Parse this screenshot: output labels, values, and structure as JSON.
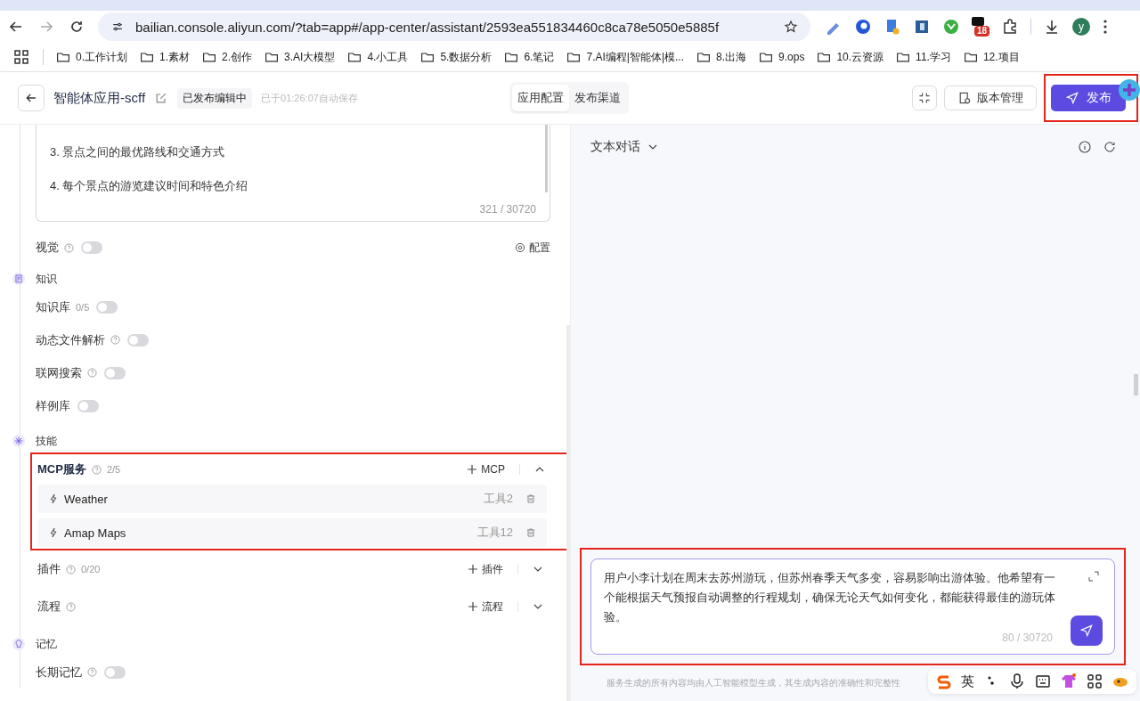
{
  "browser": {
    "url": "bailian.console.aliyun.com/?tab=app#/app-center/assistant/2593ea551834460c8ca78e5050e5885f",
    "extension_badge": "18",
    "profile_initial": "y",
    "bookmarks": [
      "0.工作计划",
      "1.素材",
      "2.创作",
      "3.AI大模型",
      "4.小工具",
      "5.数据分析",
      "6.笔记",
      "7.AI编程|智能体|模...",
      "8.出海",
      "9.ops",
      "10.云资源",
      "11.学习",
      "12.项目"
    ]
  },
  "header": {
    "title": "智能体应用-scff",
    "status_badge": "已发布编辑中",
    "autosave": "已于01:26:07自动保存",
    "tabs": [
      {
        "label": "应用配置",
        "selected": true
      },
      {
        "label": "发布渠道",
        "selected": false
      }
    ],
    "version_button": "版本管理",
    "publish_button": "发布"
  },
  "prompt_box": {
    "lines": [
      "3. 景点之间的最优路线和交通方式",
      "4. 每个景点的游览建议时间和特色介绍"
    ],
    "counter": "321 / 30720"
  },
  "vision": {
    "label": "视觉",
    "help": true,
    "on": false,
    "config_label": "配置"
  },
  "sections": [
    {
      "title": "知识",
      "kind": "knowledge",
      "items": [
        {
          "kind": "toggle",
          "label": "知识库",
          "help": false,
          "count": "0/5",
          "on": false
        },
        {
          "kind": "toggle",
          "label": "动态文件解析",
          "help": true,
          "on": false
        },
        {
          "kind": "toggle",
          "label": "联网搜索",
          "help": true,
          "on": false
        },
        {
          "kind": "toggle",
          "label": "样例库",
          "help": false,
          "on": false
        }
      ]
    },
    {
      "title": "技能",
      "kind": "skills",
      "items": [
        {
          "kind": "group",
          "label": "MCP服务",
          "help": true,
          "count": "2/5",
          "add_label": "MCP",
          "expanded": true,
          "highlighted": true,
          "children": [
            {
              "name": "Weather",
              "tools": "工具2"
            },
            {
              "name": "Amap Maps",
              "tools": "工具12"
            }
          ]
        },
        {
          "kind": "group",
          "label": "插件",
          "help": true,
          "count": "0/20",
          "add_label": "插件",
          "expanded": false,
          "highlighted": false
        },
        {
          "kind": "group",
          "label": "流程",
          "help": true,
          "add_label": "流程",
          "expanded": false,
          "highlighted": false
        }
      ]
    },
    {
      "title": "记忆",
      "kind": "memory",
      "items": [
        {
          "kind": "toggle",
          "label": "长期记忆",
          "help": true,
          "on": false
        }
      ]
    }
  ],
  "chat": {
    "mode_label": "文本对话",
    "input_text": "用户小李计划在周末去苏州游玩，但苏州春季天气多变，容易影响出游体验。他希望有一个能根据天气预报自动调整的行程规划，确保无论天气如何变化，都能获得最佳的游玩体验。",
    "counter": "80 / 30720",
    "disclaimer": "服务生成的所有内容均由人工智能模型生成，其生成内容的准确性和完整性"
  },
  "ime": {
    "language": "英"
  }
}
